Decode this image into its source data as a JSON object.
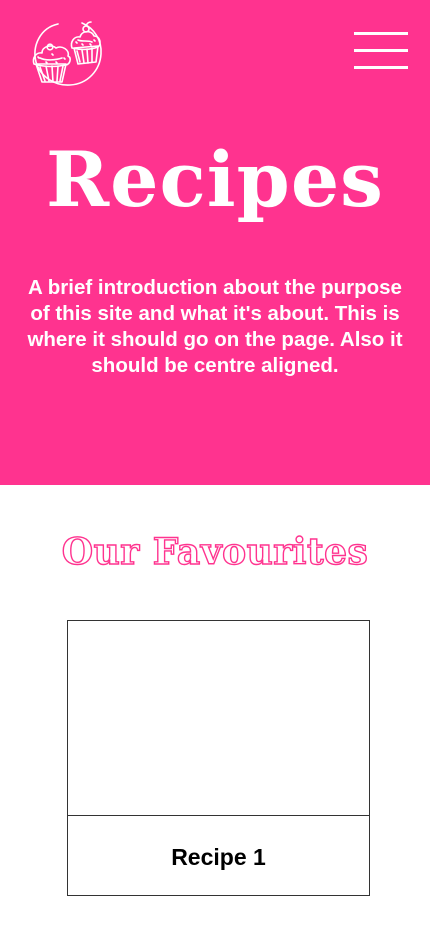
{
  "header": {
    "logo_icon": "cupcake-logo-icon",
    "menu_icon": "hamburger-menu-icon",
    "title": "Recipes",
    "intro": "A brief introduction about the purpose of this site and what it's about. This is where it should go on the page. Also it should be centre aligned."
  },
  "favourites": {
    "title": "Our Favourites",
    "cards": [
      {
        "label": "Recipe 1"
      }
    ]
  },
  "colors": {
    "brand_pink": "#ff338f",
    "background": "#ffffff",
    "text_dark": "#000000"
  }
}
